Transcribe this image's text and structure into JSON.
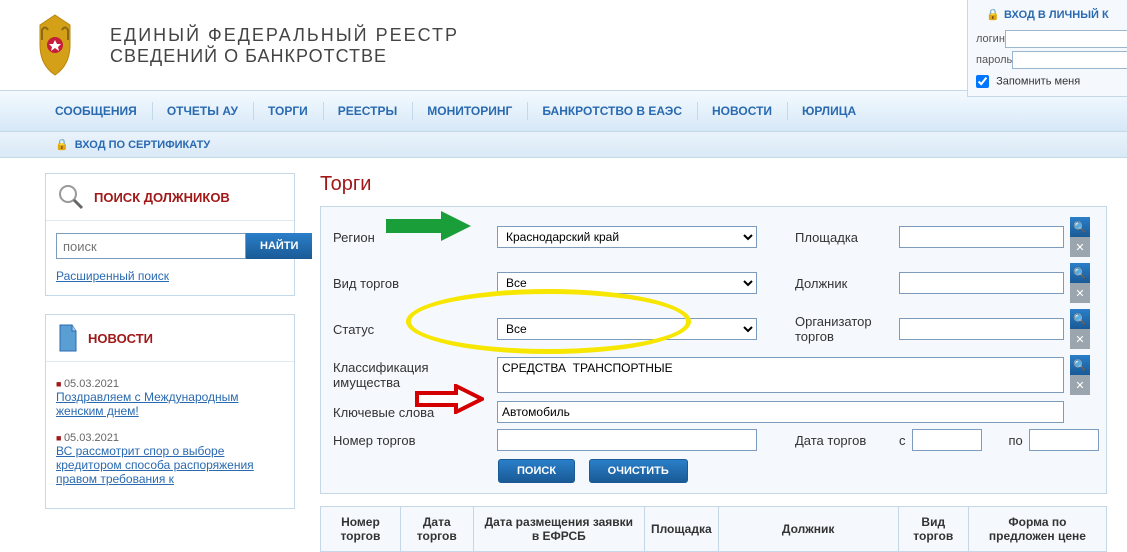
{
  "header": {
    "title_line1": "ЕДИНЫЙ  ФЕДЕРАЛЬНЫЙ  РЕЕСТР",
    "title_line2": "СВЕДЕНИЙ О БАНКРОТСТВЕ"
  },
  "login": {
    "header": "ВХОД В ЛИЧНЫЙ К",
    "login_label": "логин",
    "password_label": "пароль",
    "remember_label": "Запомнить меня"
  },
  "nav": {
    "items": [
      "СООБЩЕНИЯ",
      "ОТЧЕТЫ АУ",
      "ТОРГИ",
      "РЕЕСТРЫ",
      "МОНИТОРИНГ",
      "БАНКРОТСТВО В ЕАЭС",
      "НОВОСТИ",
      "ЮРЛИЦА"
    ]
  },
  "cert_login": "ВХОД ПО СЕРТИФИКАТУ",
  "sidebar": {
    "search_title": "ПОИСК ДОЛЖНИКОВ",
    "search_placeholder": "поиск",
    "search_button": "НАЙТИ",
    "adv_link": "Расширенный поиск",
    "news_title": "НОВОСТИ",
    "news": [
      {
        "date": "05.03.2021",
        "text": "Поздравляем с Международным женским днем!"
      },
      {
        "date": "05.03.2021",
        "text": "ВС рассмотрит спор о выборе кредитором способа распоряжения правом требования к"
      }
    ]
  },
  "content": {
    "title": "Торги",
    "labels": {
      "region": "Регион",
      "type": "Вид торгов",
      "status": "Статус",
      "classification": "Классификация имущества",
      "keywords": "Ключевые слова",
      "number": "Номер торгов",
      "platform": "Площадка",
      "debtor": "Должник",
      "organizer": "Организатор торгов",
      "date": "Дата торгов",
      "date_from": "с",
      "date_to": "по"
    },
    "values": {
      "region": "Краснодарский край",
      "type": "Все",
      "status": "Все",
      "classification": "СРЕДСТВА  ТРАНСПОРТНЫЕ",
      "keywords": "Автомобиль",
      "number": "",
      "platform": "",
      "debtor": "",
      "organizer": "",
      "date_from": "",
      "date_to": ""
    },
    "buttons": {
      "search": "ПОИСК",
      "clear": "ОЧИСТИТЬ"
    },
    "table_headers": [
      "Номер торгов",
      "Дата торгов",
      "Дата размещения заявки в ЕФРСБ",
      "Площадка",
      "Должник",
      "Вид торгов",
      "Форма по предложен цене"
    ]
  }
}
